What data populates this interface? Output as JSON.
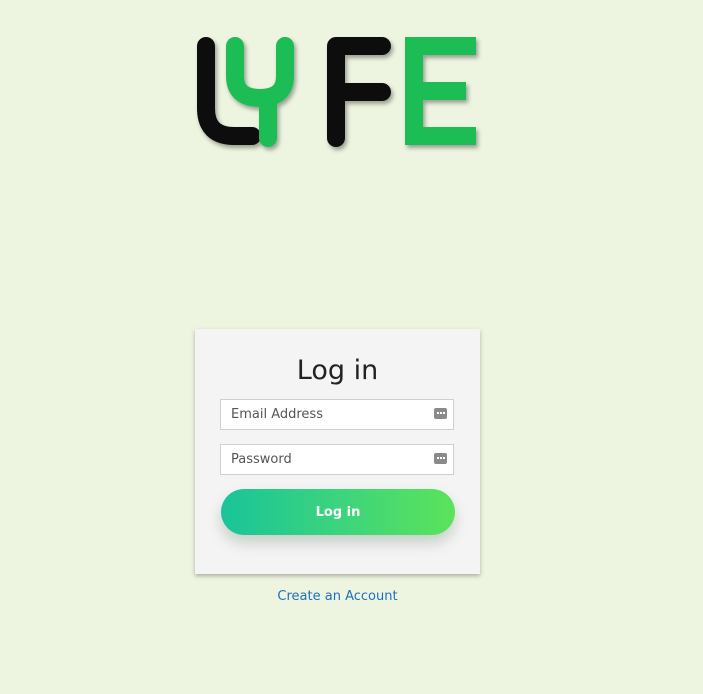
{
  "logo": {
    "text": "LYFE",
    "colors": {
      "dark": "#111111",
      "green": "#1fbd55"
    }
  },
  "login": {
    "title": "Log in",
    "email_placeholder": "Email Address",
    "password_placeholder": "Password",
    "submit_label": "Log in",
    "fields": [
      {
        "name": "email",
        "placeholder": "Email Address",
        "icon": "password-manager-key-icon"
      },
      {
        "name": "password",
        "placeholder": "Password",
        "icon": "password-manager-key-icon"
      }
    ]
  },
  "links": {
    "create_account": "Create an Account"
  },
  "colors": {
    "background": "#edf4e0",
    "button_gradient_start": "#19c49a",
    "button_gradient_end": "#5ce35a",
    "link": "#1e6fc0"
  }
}
